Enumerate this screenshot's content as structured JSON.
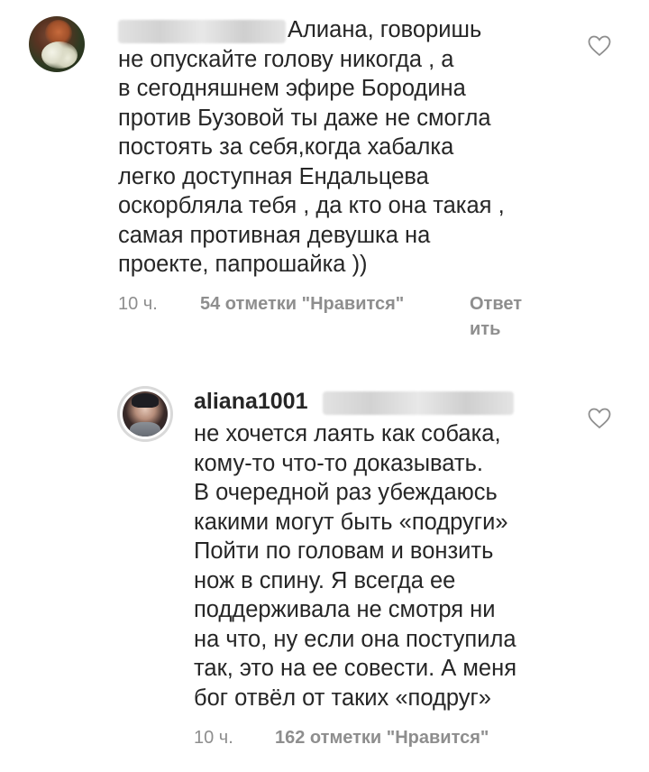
{
  "comments": [
    {
      "username": "",
      "text": "Алиана, говоришь\nне опускайте голову никогда , а\nв сегодняшнем эфире Бородина\nпротив Бузовой ты даже не смогла\nпостоять за себя,когда хабалка\nлегко доступная Ендальцева\nоскорбляла тебя , да кто она такая ,\nсамая противная девушка на\nпроекте, папрошайка ))",
      "time": "10 ч.",
      "likes": "54 отметки \"Нравится\"",
      "reply": "Ответ\nить",
      "avatar_icon": "profile-photo",
      "like_icon": "heart-outline-icon"
    },
    {
      "username": "aliana1001",
      "text": "не хочется лаять как собака,\nкому-то что-то доказывать.\nВ очередной раз убеждаюсь\nкакими могут быть «подруги»\nПойти по головам и вонзить\nнож в спину. Я всегда ее\nподдерживала не смотря ни\nна что, ну если она поступила\nтак, это на ее совести. А меня\nбог отвёл от таких «подруг»",
      "time": "10 ч.",
      "likes": "162 отметки \"Нравится\"",
      "avatar_icon": "profile-photo-story-ring",
      "like_icon": "heart-outline-icon"
    }
  ],
  "colors": {
    "text": "#262626",
    "meta": "#8e8e8e",
    "background": "#ffffff"
  }
}
